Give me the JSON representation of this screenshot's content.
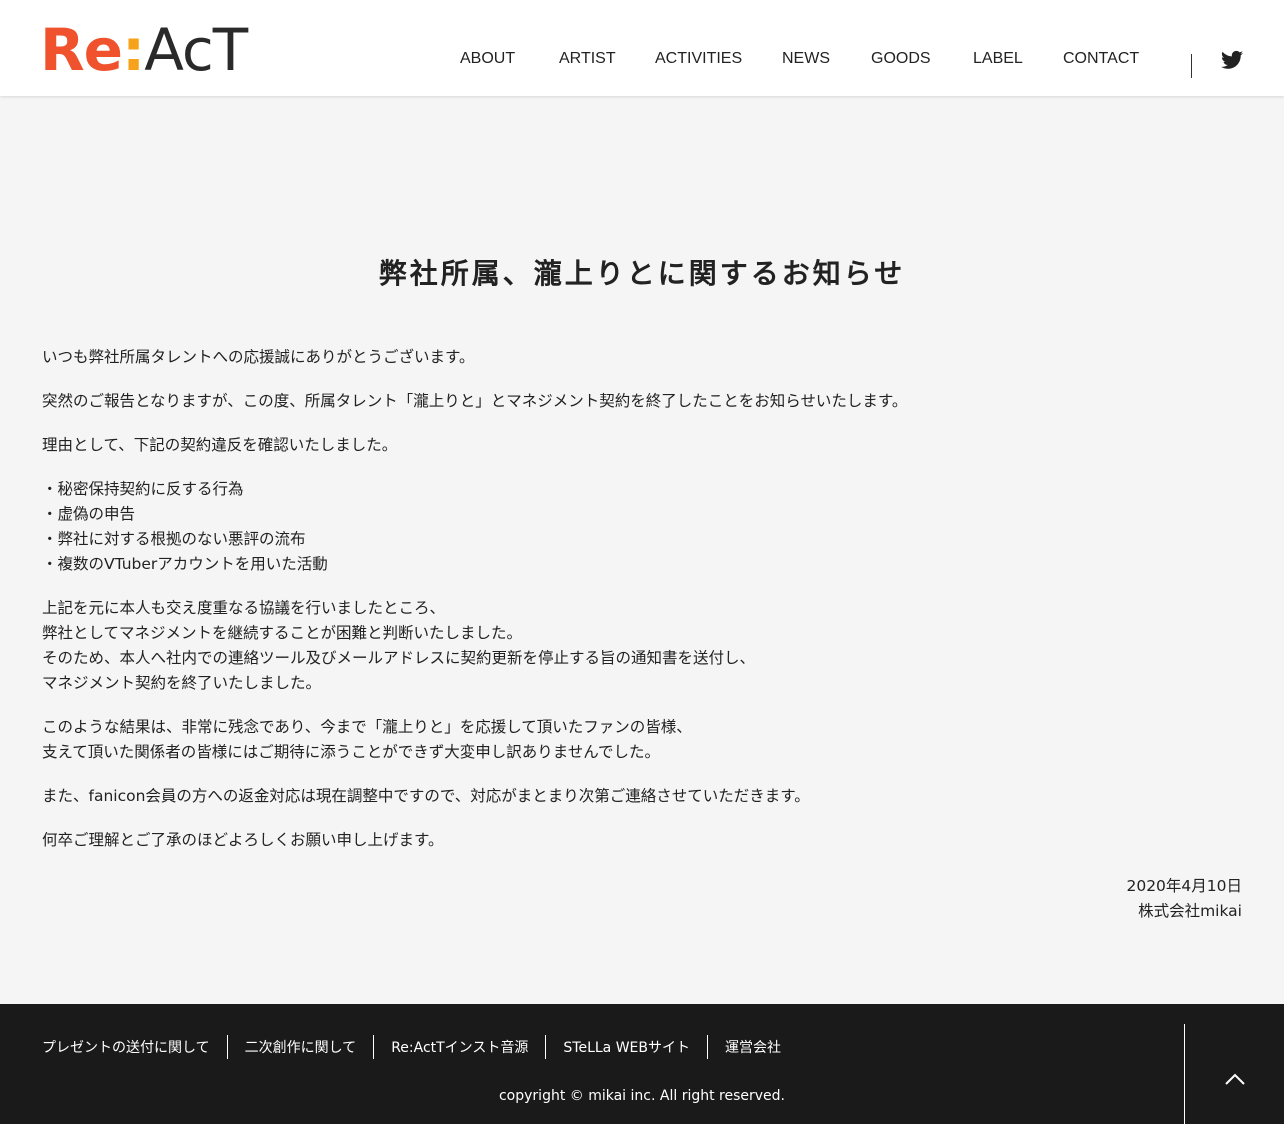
{
  "header": {
    "logo": {
      "part1": "Re",
      "part2": ":",
      "part3": "AcT"
    },
    "nav": [
      "ABOUT",
      "ARTIST",
      "ACTIVITIES",
      "NEWS",
      "GOODS",
      "LABEL",
      "CONTACT"
    ],
    "twitter_icon": "twitter-icon"
  },
  "article": {
    "title": "弊社所属、瀧上りとに関するお知らせ",
    "paragraphs": [
      [
        "いつも弊社所属タレントへの応援誠にありがとうございます。"
      ],
      [
        "突然のご報告となりますが、この度、所属タレント「瀧上りと」とマネジメント契約を終了したことをお知らせいたします。"
      ],
      [
        "理由として、下記の契約違反を確認いたしました。"
      ],
      [
        "・秘密保持契約に反する行為",
        "・虚偽の申告",
        "・弊社に対する根拠のない悪評の流布",
        "・複数のVTuberアカウントを用いた活動"
      ],
      [
        "上記を元に本人も交え度重なる協議を行いましたところ、",
        "弊社としてマネジメントを継続することが困難と判断いたしました。",
        "そのため、本人へ社内での連絡ツール及びメールアドレスに契約更新を停止する旨の通知書を送付し、",
        "マネジメント契約を終了いたしました。"
      ],
      [
        "このような結果は、非常に残念であり、今まで「瀧上りと」を応援して頂いたファンの皆様、",
        "支えて頂いた関係者の皆様にはご期待に添うことができず大変申し訳ありませんでした。"
      ],
      [
        "また、fanicon会員の方への返金対応は現在調整中ですので、対応がまとまり次第ご連絡させていただきます。"
      ],
      [
        "何卒ご理解とご了承のほどよろしくお願い申し上げます。"
      ]
    ],
    "date": "2020年4月10日",
    "company": "株式会社mikai"
  },
  "footer": {
    "links": [
      "プレゼントの送付に関して",
      "二次創作に関して",
      "Re:ActTインスト音源",
      "STeLLa WEBサイト",
      "運営会社"
    ],
    "copyright": "copyright © mikai inc. All right reserved."
  },
  "colors": {
    "accent_red": "#f0522d",
    "accent_orange": "#f7a21b",
    "footer_bg": "#1a1a1a",
    "page_bg": "#f5f5f5"
  }
}
